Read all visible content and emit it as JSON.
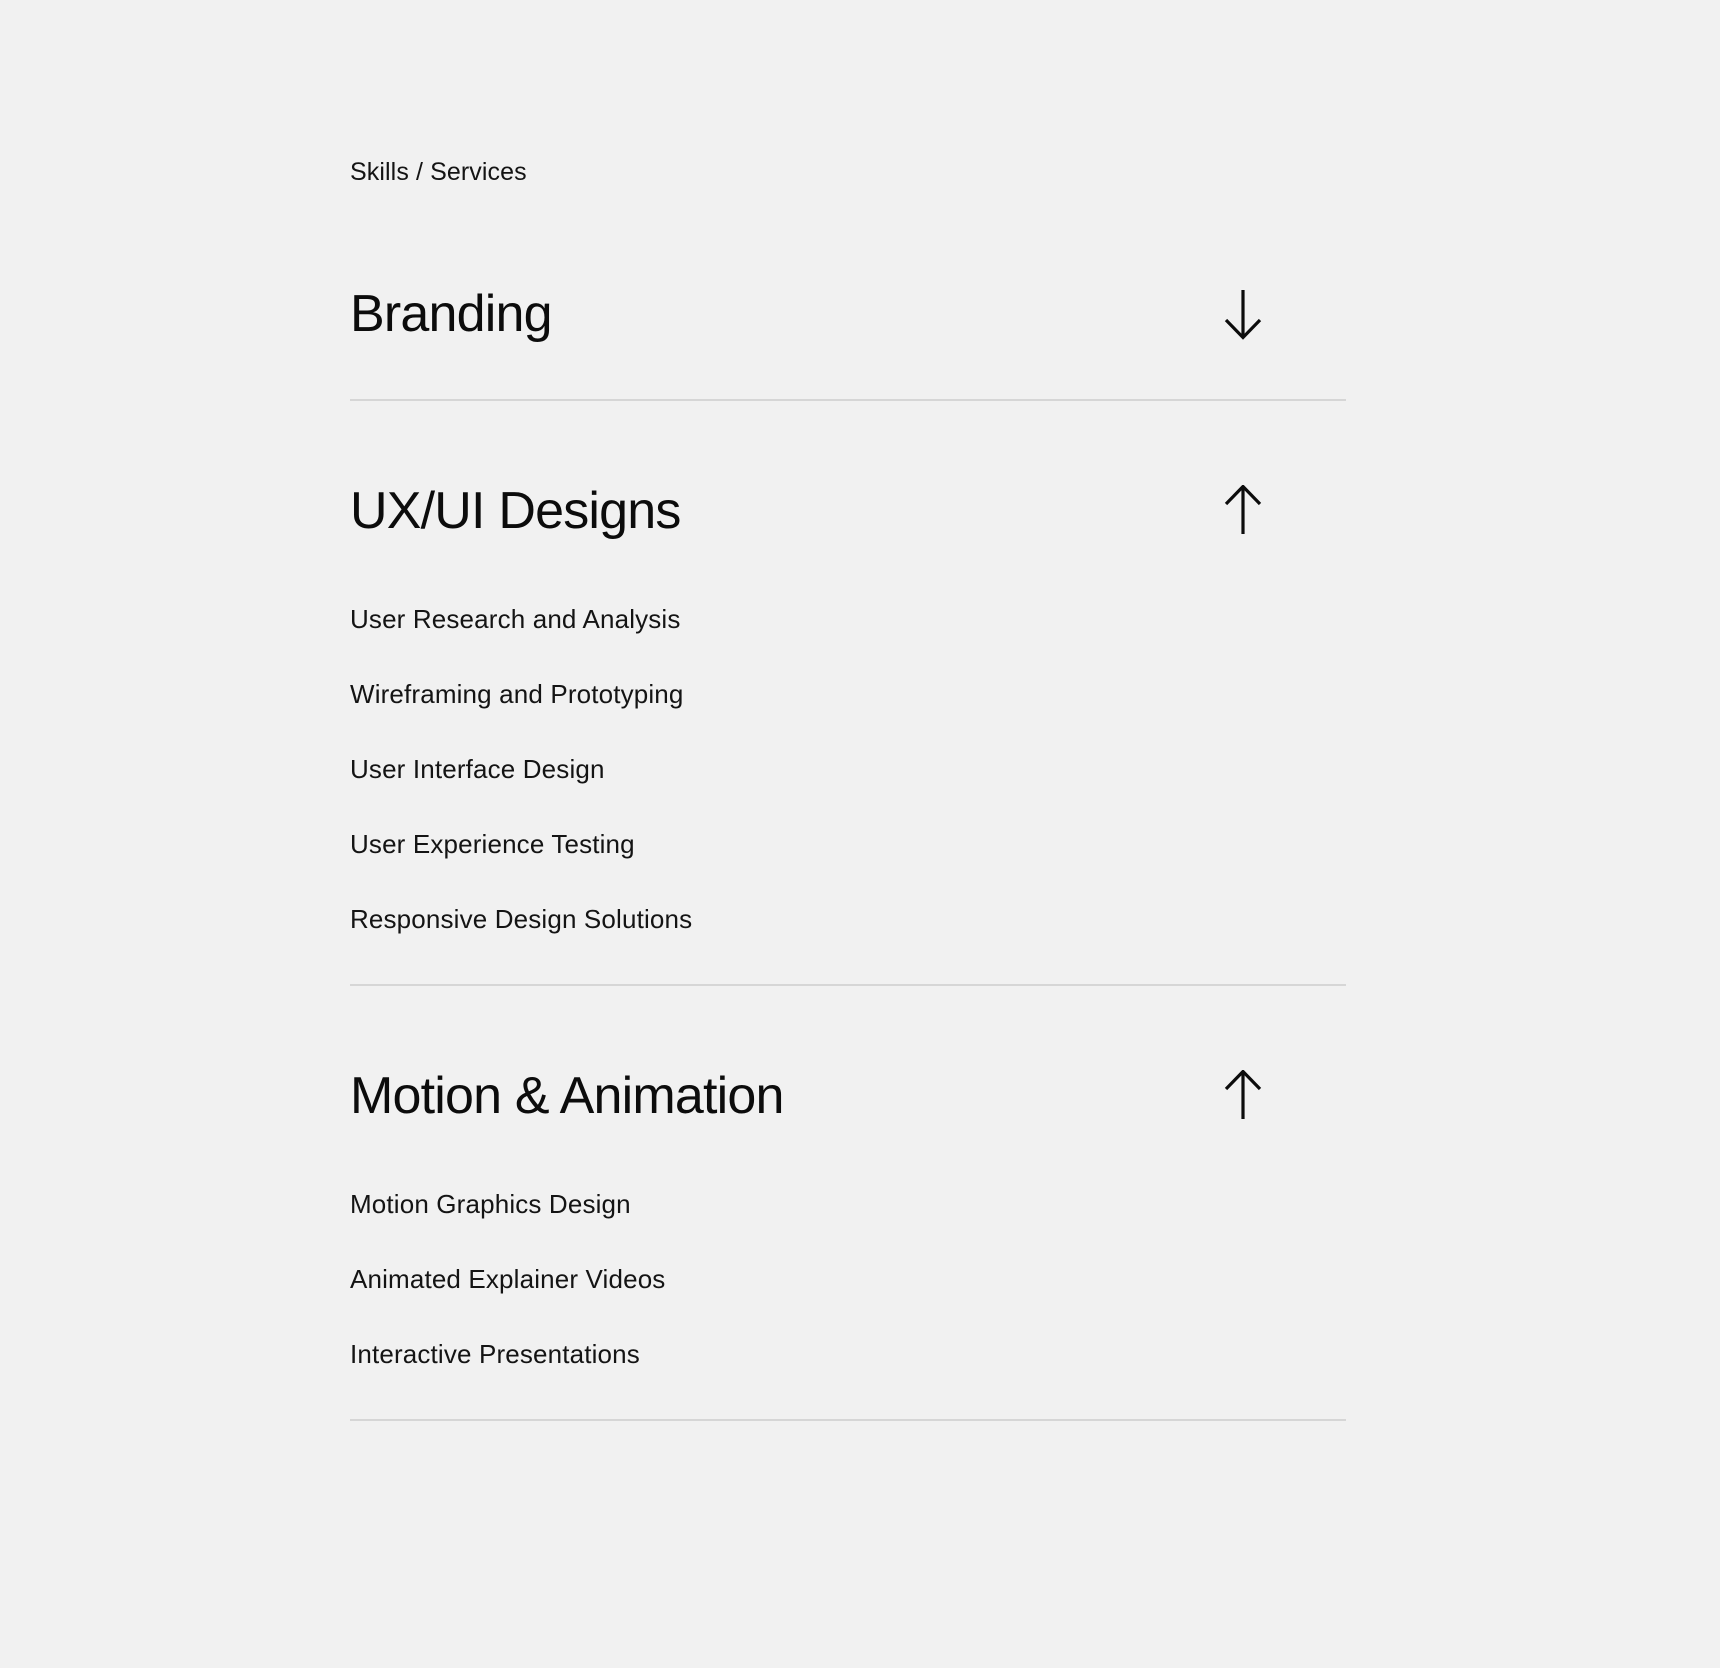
{
  "theme": {
    "background": "#f1f1f1",
    "text": "#111111",
    "divider": "#d6d6d6"
  },
  "section": {
    "label": "Skills / Services"
  },
  "accordion": {
    "items": [
      {
        "title": "Branding",
        "state": "collapsed",
        "arrow_icon": "arrow-down-icon",
        "services": []
      },
      {
        "title": "UX/UI Designs",
        "state": "expanded",
        "arrow_icon": "arrow-up-icon",
        "services": [
          "User Research and Analysis",
          "Wireframing and Prototyping",
          "User Interface Design",
          "User Experience Testing",
          "Responsive Design Solutions"
        ]
      },
      {
        "title": "Motion & Animation",
        "state": "expanded",
        "arrow_icon": "arrow-up-icon",
        "services": [
          "Motion Graphics Design",
          "Animated Explainer Videos",
          "Interactive Presentations"
        ]
      }
    ]
  }
}
